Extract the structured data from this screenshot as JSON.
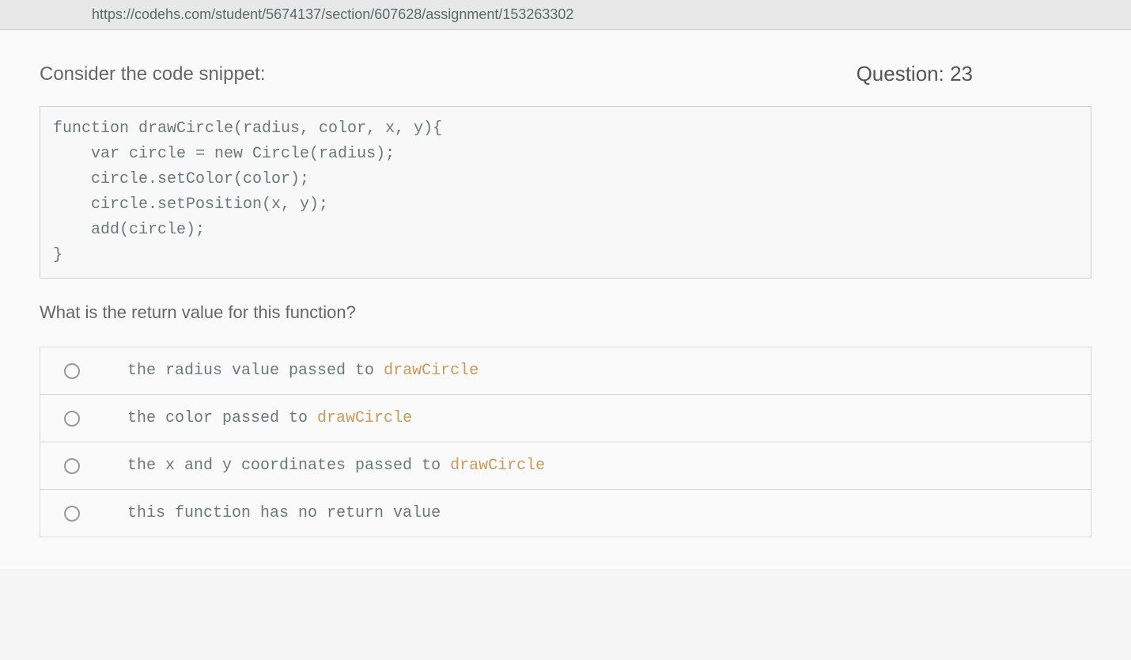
{
  "url": "https://codehs.com/student/5674137/section/607628/assignment/153263302",
  "header": {
    "prompt": "Consider the code snippet:",
    "question_label": "Question: 23"
  },
  "code_snippet": "function drawCircle(radius, color, x, y){\n    var circle = new Circle(radius);\n    circle.setColor(color);\n    circle.setPosition(x, y);\n    add(circle);\n}",
  "question": "What is the return value for this function?",
  "options": [
    {
      "text": "the radius value passed to ",
      "highlight": "drawCircle"
    },
    {
      "text": "the color passed to ",
      "highlight": "drawCircle"
    },
    {
      "text": "the x and y coordinates passed to ",
      "highlight": "drawCircle"
    },
    {
      "text": "this function has no return value",
      "highlight": ""
    }
  ]
}
